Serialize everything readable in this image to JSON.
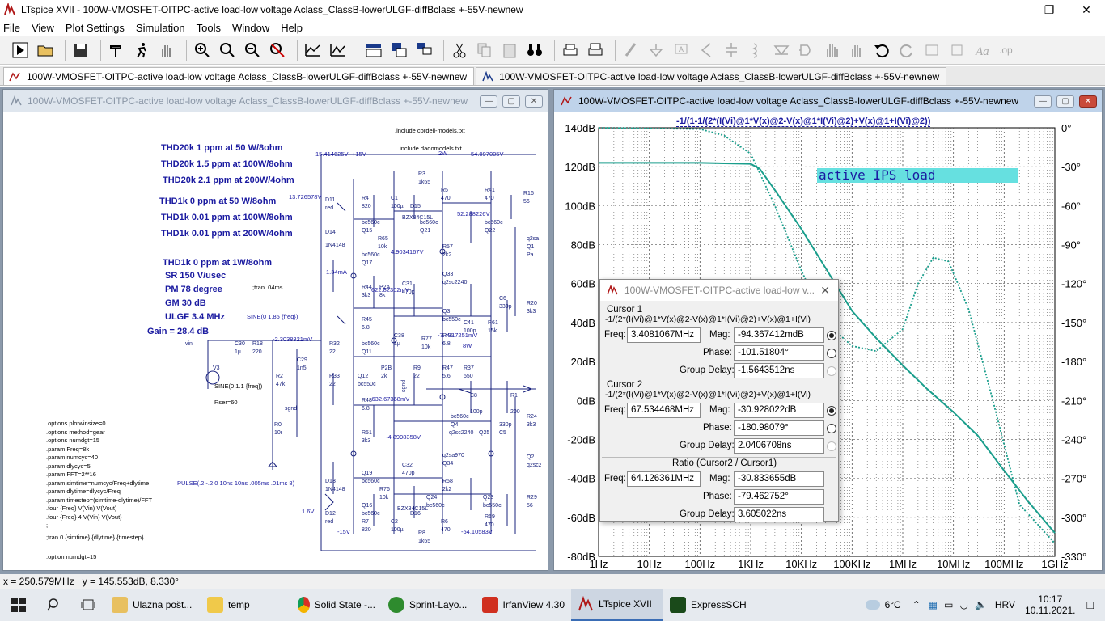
{
  "app": {
    "title": "LTspice XVII - 100W-VMOSFET-OITPC-active load-low voltage Aclass_ClassB-lowerULGF-diffBclass +-55V-newnew"
  },
  "menu": [
    "File",
    "View",
    "Plot Settings",
    "Simulation",
    "Tools",
    "Window",
    "Help"
  ],
  "tabs": [
    {
      "label": "100W-VMOSFET-OITPC-active load-low voltage Aclass_ClassB-lowerULGF-diffBclass +-55V-newnew"
    },
    {
      "label": "100W-VMOSFET-OITPC-active load-low voltage Aclass_ClassB-lowerULGF-diffBclass +-55V-newnew"
    }
  ],
  "schematic": {
    "title": "100W-VMOSFET-OITPC-active load-low voltage Aclass_ClassB-lowerULGF-diffBclass +-55V-newnew",
    "notes": [
      "THD20k 1 ppm at 50 W/8ohm",
      "THD20k 1.5 ppm at 100W/8ohm",
      "THD20k 2.1 ppm at 200W/4ohm",
      "THD1k 0 ppm at 50 W/8ohm",
      "THD1k 0.01 ppm at 100W/8ohm",
      "THD1k 0.01  ppm at 200W/4ohm",
      "THD1k 0 ppm at 1W/8ohm",
      "SR 150 V/usec",
      "PM  78 degree",
      "GM  30 dB",
      "ULGF 3.4 MHz",
      "Gain = 28.4 dB"
    ],
    "directives": [
      ".options plotwinsize=0",
      ".options method=gear",
      ".options numdgt=15",
      ".param Freq=8k",
      ".param numcyc=40",
      ".param dlycyc=5",
      ".param FFT=2**16",
      ".param simtime=numcyc/Freq+dlytime",
      ".param dlytime=dlycyc/Freq",
      ".param timestep=(simtime-dlytime)/FFT",
      ".four {Freq} V(Vin) V(Vout)",
      ".four {Freq} 4 V(Vin) V(Vout)",
      ";",
      ";tran 0 {simtime} {dlytime} {timestep}",
      "",
      ".option numdgt=15"
    ],
    "includes": [
      ".include cordell-models.txt",
      ".include dadomodels.txt"
    ],
    "tran": ";tran .04ms",
    "sine1": "SINE(0 1.85 {freq})",
    "sine2": "SINE(0 1.1 {freq})",
    "rser": "Rser=60",
    "pulse": "PULSE(.2 -.2 0 10ns 10ns .005ms .01ms 8)",
    "voltages": [
      "15.414625V",
      "+15V",
      "54.097005V",
      "13.726578V",
      "52.288226V",
      "4.9034167V",
      "622.82302mV",
      "-2.3038821mV",
      "-7.4917251mV",
      "-632.67368mV",
      "-4.8998358V",
      "-54.10583V",
      "1.34mA",
      "2W",
      "8W",
      "1.6V",
      "-15V"
    ]
  },
  "plot": {
    "title": "100W-VMOSFET-OITPC-active load-low voltage Aclass_ClassB-lowerULGF-diffBclass +-55V-newnew",
    "trace_expr": "-1/(1-1/(2*(I(Vi)@1*V(x)@2-V(x)@1*I(Vi)@2)+V(x)@1+I(Vi)@2))",
    "annotation": "active IPS load",
    "y_left_ticks": [
      "140dB",
      "120dB",
      "100dB",
      "80dB",
      "60dB",
      "40dB",
      "20dB",
      "0dB",
      "-20dB",
      "-40dB",
      "-60dB",
      "-80dB"
    ],
    "y_right_ticks": [
      "0°",
      "-30°",
      "-60°",
      "-90°",
      "-120°",
      "-150°",
      "-180°",
      "-210°",
      "-240°",
      "-270°",
      "-300°",
      "-330°"
    ],
    "x_ticks": [
      "1Hz",
      "10Hz",
      "100Hz",
      "1KHz",
      "10KHz",
      "100KHz",
      "1MHz",
      "10MHz",
      "100MHz",
      "1GHz"
    ],
    "colors": {
      "magnitude": "#1a9e8c",
      "phase": "#1a9e8c",
      "label_bg": "#66e0e0",
      "label_text": "#1a1aa0"
    }
  },
  "chart_data": {
    "type": "line",
    "title": "-1/(1-1/(2*(I(Vi)@1*V(x)@2-V(x)@1*I(Vi)@2)+V(x)@1+I(Vi)@2))",
    "xscale": "log",
    "xlim": [
      1,
      1000000000
    ],
    "ylim": [
      -80,
      140
    ],
    "y2lim": [
      -330,
      0
    ],
    "xlabel": "",
    "ylabel": "",
    "series": [
      {
        "style": "solid",
        "axis": "left",
        "x": [
          1,
          100,
          1000,
          1500,
          3000,
          10000,
          30000,
          100000,
          300000,
          1000000,
          3000000,
          10000000,
          30000000,
          100000000,
          300000000,
          1000000000
        ],
        "y": [
          122,
          122,
          121.5,
          119,
          108,
          88,
          68,
          46,
          32,
          18,
          6,
          -6,
          -18,
          -36,
          -52,
          -68
        ]
      },
      {
        "style": "dotted",
        "axis": "right",
        "x": [
          1,
          100,
          300,
          1000,
          3000,
          10000,
          30000,
          100000,
          300000,
          1000000,
          2000000,
          4000000,
          8000000,
          20000000,
          60000000,
          200000000,
          1000000000
        ],
        "y": [
          0,
          -1,
          -6,
          -20,
          -60,
          -110,
          -150,
          -168,
          -172,
          -155,
          -120,
          -100,
          -103,
          -140,
          -210,
          -290,
          -320
        ]
      }
    ]
  },
  "cursor_dialog": {
    "title": "100W-VMOSFET-OITPC-active load-low v...",
    "cursor1_label": "Cursor 1",
    "cursor1_expr": "-1/(2*(I(Vi)@1*V(x)@2-V(x)@1*I(Vi)@2)+V(x)@1+I(Vi)",
    "cursor1_freq": "3.4081067MHz",
    "cursor1_mag": "-94.367412mdB",
    "cursor1_phase": "-101.51804°",
    "cursor1_gd": "-1.5643512ns",
    "cursor2_label": "Cursor 2",
    "cursor2_expr": "-1/(2*(I(Vi)@1*V(x)@2-V(x)@1*I(Vi)@2)+V(x)@1+I(Vi)",
    "cursor2_freq": "67.534468MHz",
    "cursor2_mag": "-30.928022dB",
    "cursor2_phase": "-180.98079°",
    "cursor2_gd": "2.0406708ns",
    "ratio_label": "Ratio (Cursor2 / Cursor1)",
    "ratio_freq": "64.126361MHz",
    "ratio_mag": "-30.833655dB",
    "ratio_phase": "-79.462752°",
    "ratio_gd": "3.605022ns",
    "freq_label": "Freq:",
    "mag_label": "Mag:",
    "phase_label": "Phase:",
    "gd_label": "Group Delay:"
  },
  "status": {
    "text": "x = 250.579MHz   y = 145.553dB, 8.330°"
  },
  "taskbar": {
    "items": [
      "Ulazna pošt...",
      "temp",
      "Solid State -...",
      "Sprint-Layo...",
      "IrfanView 4.30",
      "LTspice XVII",
      "ExpressSCH"
    ],
    "weather": "6°C",
    "lang": "HRV",
    "time": "10:17",
    "date": "10.11.2021."
  }
}
